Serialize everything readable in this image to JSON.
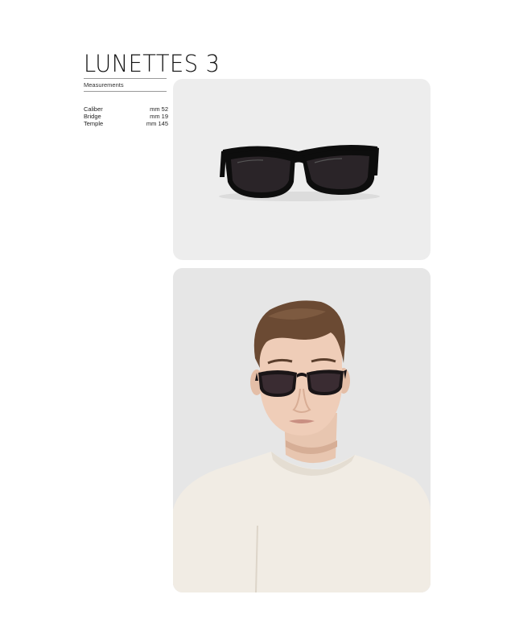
{
  "product": {
    "title": "LUNETTES 3",
    "section_label": "Measurements"
  },
  "measurements": [
    {
      "label": "Caliber",
      "value": "mm 52"
    },
    {
      "label": "Bridge",
      "value": "mm 19"
    },
    {
      "label": "Temple",
      "value": "mm 145"
    }
  ],
  "images": {
    "product_photo": "sunglasses-product-photo",
    "model_photo": "model-wearing-sunglasses-photo"
  },
  "colors": {
    "frame": "#0d0d0d",
    "lens": "#2a2428",
    "panel": "#ededed"
  }
}
